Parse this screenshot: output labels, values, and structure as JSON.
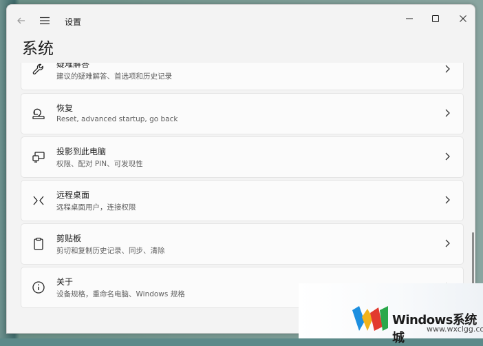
{
  "window": {
    "app_title": "设置",
    "page_title": "系统"
  },
  "icons": {
    "back": "back-arrow-icon",
    "menu": "hamburger-menu-icon",
    "minimize": "minimize-icon",
    "maximize": "maximize-icon",
    "close": "close-icon"
  },
  "items": [
    {
      "title": "疑难解答",
      "subtitle": "建议的疑难解答、首选项和历史记录",
      "icon": "wrench-icon"
    },
    {
      "title": "恢复",
      "subtitle": "Reset, advanced startup, go back",
      "icon": "recovery-icon"
    },
    {
      "title": "投影到此电脑",
      "subtitle": "权限、配对 PIN、可发现性",
      "icon": "project-to-pc-icon"
    },
    {
      "title": "远程桌面",
      "subtitle": "远程桌面用户，连接权限",
      "icon": "remote-desktop-icon"
    },
    {
      "title": "剪贴板",
      "subtitle": "剪切和复制历史记录、同步、清除",
      "icon": "clipboard-icon"
    },
    {
      "title": "关于",
      "subtitle": "设备规格，重命名电脑、Windows 规格",
      "icon": "info-icon"
    }
  ],
  "watermark": {
    "brand": "Windows系统城",
    "url": "www.wxclgg.com"
  },
  "colors": {
    "window_bg": "#f3f3f3",
    "card_bg": "#fbfbfb",
    "card_border": "#e5e5e5"
  }
}
